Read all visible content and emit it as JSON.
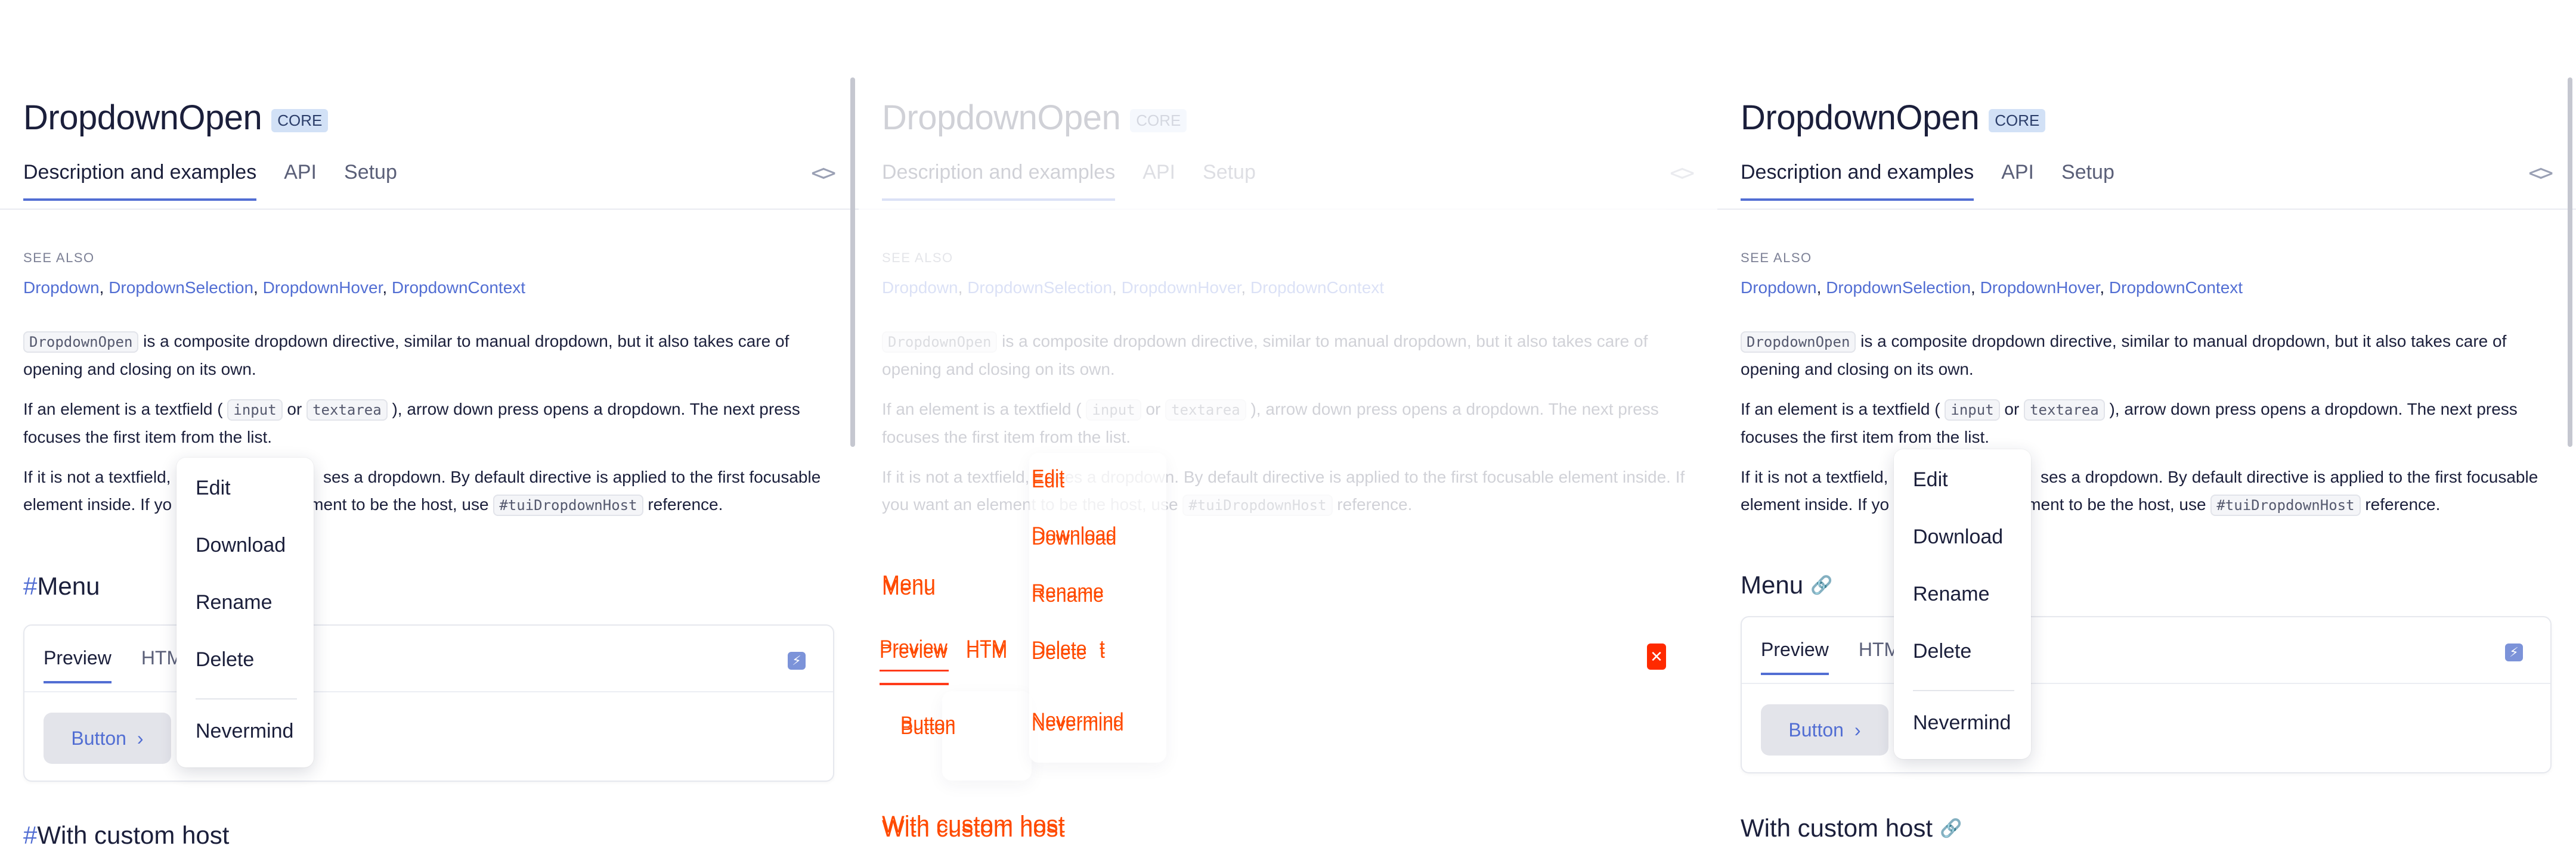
{
  "page": {
    "title": "DropdownOpen",
    "badge": "CORE",
    "tabs": [
      "Description and examples",
      "API",
      "Setup"
    ],
    "code_toggle": "<>",
    "see_also_label": "SEE ALSO",
    "see_also_links": [
      "Dropdown",
      "DropdownSelection",
      "DropdownHover",
      "DropdownContext"
    ],
    "p1": {
      "code": "DropdownOpen",
      "text": " is a composite dropdown directive, similar to manual dropdown, but it also takes care of opening and closing on its own."
    },
    "p2": {
      "before": "If an element is a textfield ( ",
      "code1": "input",
      "mid": " or ",
      "code2": "textarea",
      "after": " ), arrow down press opens a dropdown. The next press focuses the first item from the list."
    },
    "p3": {
      "before": "If it is not a textfield, it uses a dropdown. By default directive is applied to the first focusable element inside. If you want an element to be the host, use ",
      "code": "#tuiDropdownHost",
      "after": " reference."
    },
    "section_menu": "Menu",
    "section_custom_host": "With custom host",
    "demo": {
      "tabs": [
        "Preview",
        "HTML",
        "TypeScript"
      ],
      "button_label": "Button",
      "button_chevron": "›"
    },
    "dropdown_items": [
      "Edit",
      "Download",
      "Rename",
      "Delete",
      "Nevermind"
    ]
  },
  "left_pane": {
    "p3_left_visible": "If it is not a textfield,",
    "p3_right_visible": "ses a dropdown. By default directive is applied to the first focusable",
    "p3_line2_left": "element inside. If yo",
    "p3_line2_right": "ement to be the host, use",
    "p3_code": "#tuiDropdownHost",
    "p3_after": " reference.",
    "demo_tab_partial_html": "HTM",
    "demo_tab_partial_ts": "t",
    "hash": "#"
  },
  "middle_pane": {
    "ghost_title": "DropdownOpen",
    "ghost_badge": "CORE",
    "overlay_menu": "Menu",
    "overlay_custom": "With custom host",
    "overlay_preview": "Preview",
    "overlay_html": "HTM",
    "overlay_ts": "t",
    "overlay_button": "Button"
  },
  "right_pane": {
    "p3_line1_left": "If it is not a textfield,",
    "p3_line1_right": "ses a dropdown. By default directive is applied to the first focusable",
    "p3_line2_left": "element inside. If yo",
    "p3_line2_right": "ement to be the host, use",
    "demo_tab_partial_html": "HTM",
    "demo_tab_partial_ts": "t"
  },
  "colors": {
    "accent": "#526ed3",
    "text": "#1b1f3b",
    "muted": "#5a5f78",
    "overlay_red": "#ff4a00"
  }
}
